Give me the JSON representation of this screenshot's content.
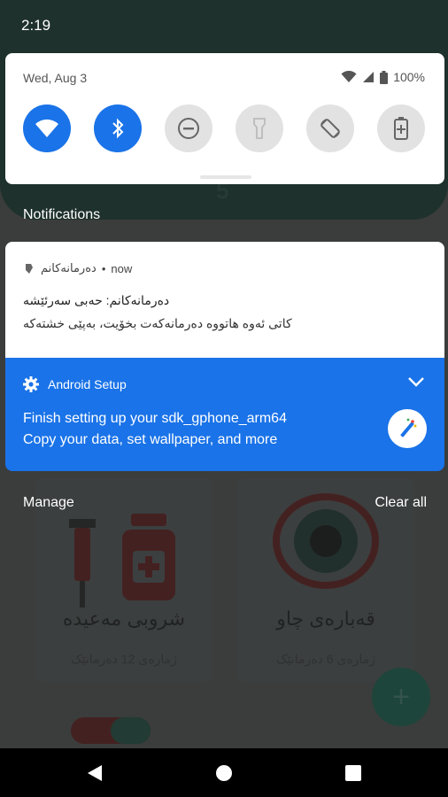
{
  "status_bar": {
    "time": "2:19"
  },
  "quick_settings": {
    "date": "Wed, Aug 3",
    "battery": "100%",
    "tiles": [
      {
        "icon": "wifi-icon",
        "state": "on"
      },
      {
        "icon": "bluetooth-icon",
        "state": "on"
      },
      {
        "icon": "do-not-disturb-icon",
        "state": "off"
      },
      {
        "icon": "flashlight-icon",
        "state": "off"
      },
      {
        "icon": "auto-rotate-icon",
        "state": "off"
      },
      {
        "icon": "battery-saver-icon",
        "state": "off"
      }
    ]
  },
  "notifications": {
    "header": "Notifications",
    "items": [
      {
        "app_name": "دەرمانەکانم",
        "time": "now",
        "title": "دەرمانەکانم: حەبی سەرئێشە",
        "text": "کاتی ئەوە هاتووە دەرمانەکەت بخۆیت، بەپێی خشتەکە"
      },
      {
        "app_name": "Android Setup",
        "title": "Finish setting up your sdk_gphone_arm64",
        "text": "Copy your data, set wallpaper, and more"
      }
    ],
    "manage_label": "Manage",
    "clear_all_label": "Clear all"
  },
  "background_app": {
    "header_digit": "5",
    "cards": [
      {
        "title": "شروبی مەعیدە",
        "subtitle": "ژمارەی 12 دەرمانێک"
      },
      {
        "title": "قەبارەی چاو",
        "subtitle": "ژمارەی 6 دەرمانێک"
      }
    ],
    "fab_label": "+"
  },
  "colors": {
    "accent": "#1a73e8",
    "panel": "#ffffff",
    "nav": "#000000"
  }
}
